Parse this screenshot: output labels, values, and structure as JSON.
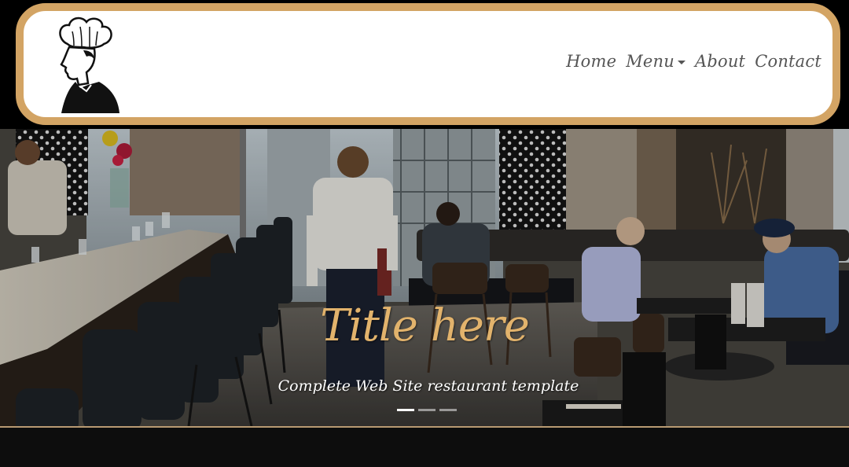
{
  "header": {
    "logo_icon": "chef-logo-icon",
    "border_color": "#d3a464",
    "nav": [
      {
        "label": "Home"
      },
      {
        "label": "Menu",
        "has_dropdown": true
      },
      {
        "label": "About"
      },
      {
        "label": "Contact"
      }
    ]
  },
  "hero": {
    "title": "Title here",
    "subtitle": "Complete Web Site restaurant template",
    "title_color": "#e2b36c",
    "slides_total": 3,
    "active_slide": 1
  }
}
